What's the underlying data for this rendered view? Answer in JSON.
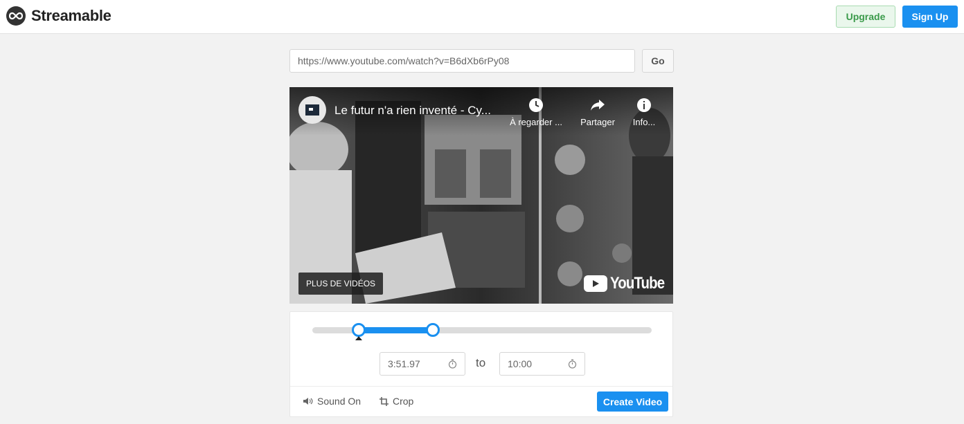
{
  "header": {
    "app_name": "Streamable",
    "upgrade_label": "Upgrade",
    "signup_label": "Sign Up"
  },
  "url_bar": {
    "value": "https://www.youtube.com/watch?v=B6dXb6rPy08",
    "go_label": "Go"
  },
  "video": {
    "title": "Le futur n'a rien inventé - Cy...",
    "actions": [
      {
        "label": "À regarder ...",
        "icon": "clock-icon"
      },
      {
        "label": "Partager",
        "icon": "share-icon"
      },
      {
        "label": "Info...",
        "icon": "info-icon"
      }
    ],
    "more_videos_label": "PLUS DE VIDÉOS",
    "provider": "YouTube"
  },
  "trim": {
    "start_fraction": 0.137,
    "end_fraction": 0.355,
    "marker_fraction": 0.137,
    "start_time": "3:51.97",
    "to_label": "to",
    "end_time": "10:00"
  },
  "tools": {
    "sound_label": "Sound On",
    "crop_label": "Crop",
    "create_label": "Create Video"
  },
  "colors": {
    "accent": "#1a90f0",
    "upgrade_green": "#3a9a4a"
  }
}
